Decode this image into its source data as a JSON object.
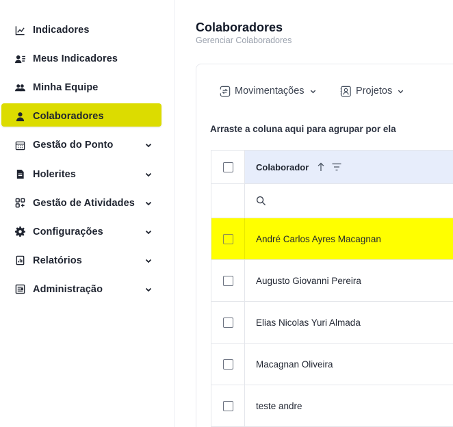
{
  "sidebar": {
    "items": [
      {
        "label": "Indicadores",
        "icon": "line-chart-icon",
        "expandable": false,
        "active": false
      },
      {
        "label": "Meus Indicadores",
        "icon": "user-list-icon",
        "expandable": false,
        "active": false
      },
      {
        "label": "Minha Equipe",
        "icon": "team-icon",
        "expandable": false,
        "active": false
      },
      {
        "label": "Colaboradores",
        "icon": "user-icon",
        "expandable": false,
        "active": true
      },
      {
        "label": "Gestão do Ponto",
        "icon": "calendar-icon",
        "expandable": true,
        "active": false
      },
      {
        "label": "Holerites",
        "icon": "document-icon",
        "expandable": true,
        "active": false
      },
      {
        "label": "Gestão de Atividades",
        "icon": "grid-icon",
        "expandable": true,
        "active": false
      },
      {
        "label": "Configurações",
        "icon": "gear-icon",
        "expandable": true,
        "active": false
      },
      {
        "label": "Relatórios",
        "icon": "report-icon",
        "expandable": true,
        "active": false
      },
      {
        "label": "Administração",
        "icon": "admin-icon",
        "expandable": true,
        "active": false
      }
    ]
  },
  "main": {
    "title": "Colaboradores",
    "subtitle": "Gerenciar Colaboradores",
    "toolbar": {
      "movimentacoes_label": "Movimentações",
      "projetos_label": "Projetos"
    },
    "group_hint": "Arraste a coluna aqui para agrupar por ela",
    "grid": {
      "column_header": "Colaborador",
      "rows": [
        {
          "name": "André Carlos Ayres Macagnan",
          "selected": true
        },
        {
          "name": "Augusto Giovanni Pereira",
          "selected": false
        },
        {
          "name": "Elias Nicolas Yuri Almada",
          "selected": false
        },
        {
          "name": "Macagnan Oliveira",
          "selected": false
        },
        {
          "name": "teste andre",
          "selected": false
        }
      ]
    }
  },
  "colors": {
    "active_nav_bg": "#dcdc00",
    "selected_row_bg": "#ffff00",
    "header_bg": "#e7edfb"
  }
}
